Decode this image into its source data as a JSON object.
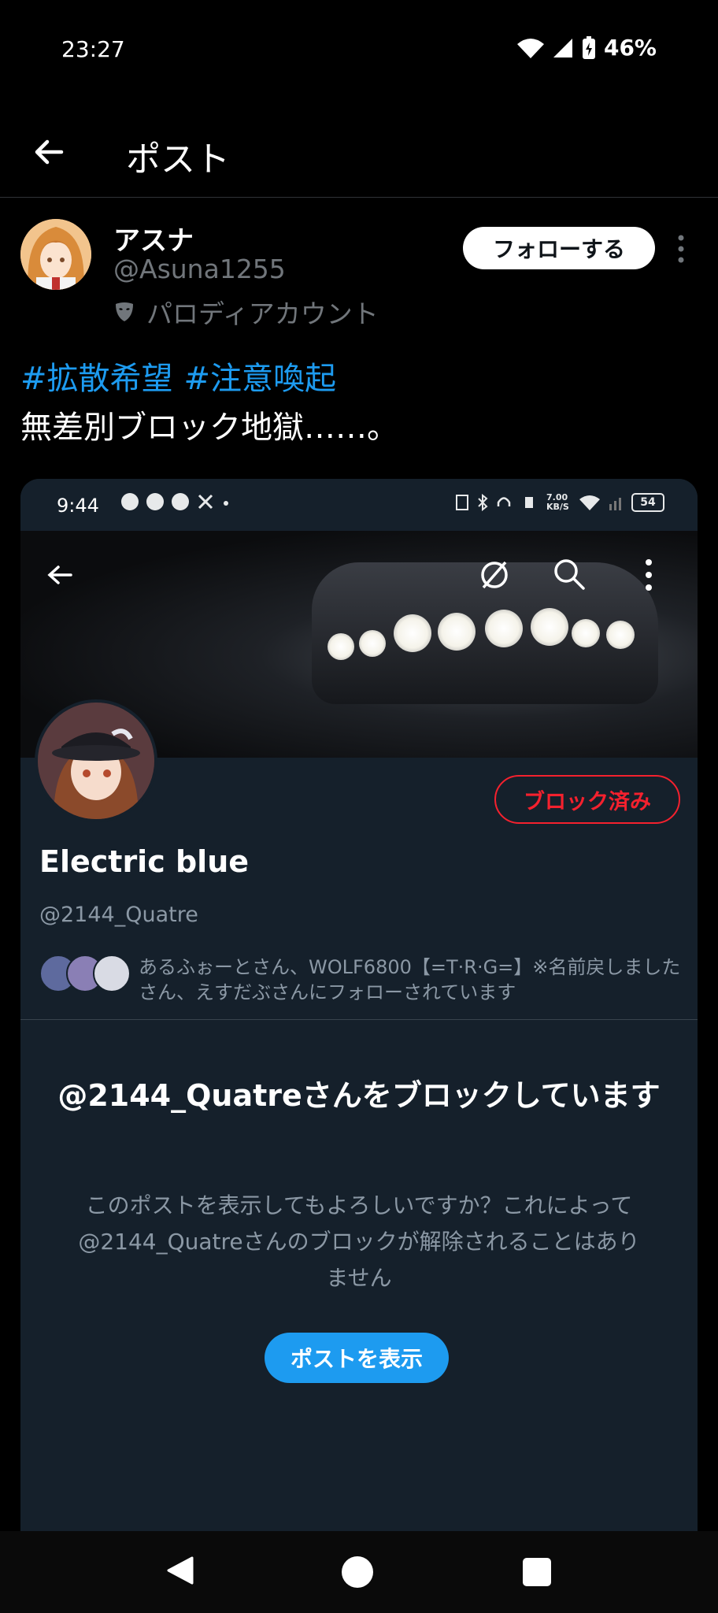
{
  "status_bar": {
    "time": "23:27",
    "battery": "46%"
  },
  "header": {
    "title": "ポスト"
  },
  "post": {
    "author_name": "アスナ",
    "author_handle": "@Asuna1255",
    "parody_label": "パロディアカウント",
    "follow_label": "フォローする",
    "hashtags": [
      "#拡散希望",
      "#注意喚起"
    ],
    "text": "無差別ブロック地獄……。"
  },
  "embedded": {
    "status_time": "9:44",
    "status_speed": "7.00 KB/S",
    "status_battery": "54",
    "profile_name": "Electric blue",
    "profile_handle": "@2144_Quatre",
    "blocked_label": "ブロック済み",
    "followers_text": "あるふぉーとさん、WOLF6800【=T·R·G=】※名前戻しましたさん、えすだぶさんにフォローされています",
    "block_title": "@2144_Quatreさんをブロックしています",
    "block_desc": "このポストを表示してもよろしいですか？これによって@2144_Quatreさんのブロックが解除されることはありません",
    "show_post_label": "ポストを表示"
  },
  "colors": {
    "accent": "#1d9bf0",
    "danger": "#f4212e",
    "background": "#000000",
    "card": "#15202b"
  }
}
